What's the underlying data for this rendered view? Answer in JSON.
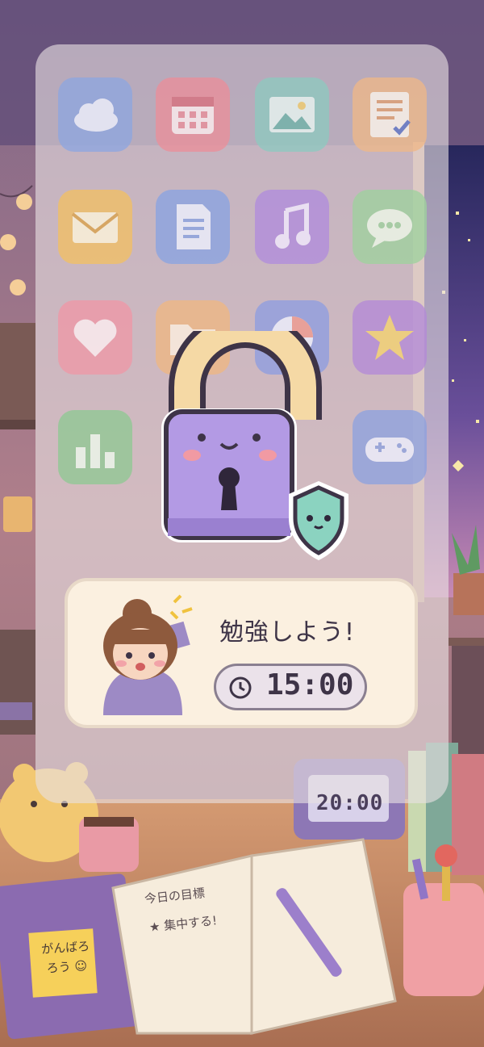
{
  "app_grid": {
    "icons": [
      {
        "name": "cloud-icon",
        "color": "#8fa7e0"
      },
      {
        "name": "calendar-icon",
        "color": "#eb8f9a"
      },
      {
        "name": "photo-icon",
        "color": "#8fc9c0"
      },
      {
        "name": "notes-check-icon",
        "color": "#efb889"
      },
      {
        "name": "mail-icon",
        "color": "#f2c064"
      },
      {
        "name": "document-icon",
        "color": "#8aa4e2"
      },
      {
        "name": "music-icon",
        "color": "#b18ddd"
      },
      {
        "name": "chat-icon",
        "color": "#9fd29e"
      },
      {
        "name": "heart-icon",
        "color": "#ef98a7"
      },
      {
        "name": "folder-icon",
        "color": "#efb783"
      },
      {
        "name": "pie-chart-icon",
        "color": "#8f9ee0"
      },
      {
        "name": "star-icon",
        "color": "#b48ad8"
      },
      {
        "name": "bar-chart-icon",
        "color": "#90c994"
      },
      {
        "name": "gamepad-icon",
        "color": "#8ea2df"
      }
    ]
  },
  "lock": {
    "status": "locked"
  },
  "motivation": {
    "title": "勉強しよう!",
    "timer": "15:00"
  },
  "desk": {
    "clock_display": "20:00",
    "notebook_line1": "今日の目標",
    "notebook_line2": "★ 集中する!",
    "sticky_note_text": "がんばろろう ☺"
  }
}
